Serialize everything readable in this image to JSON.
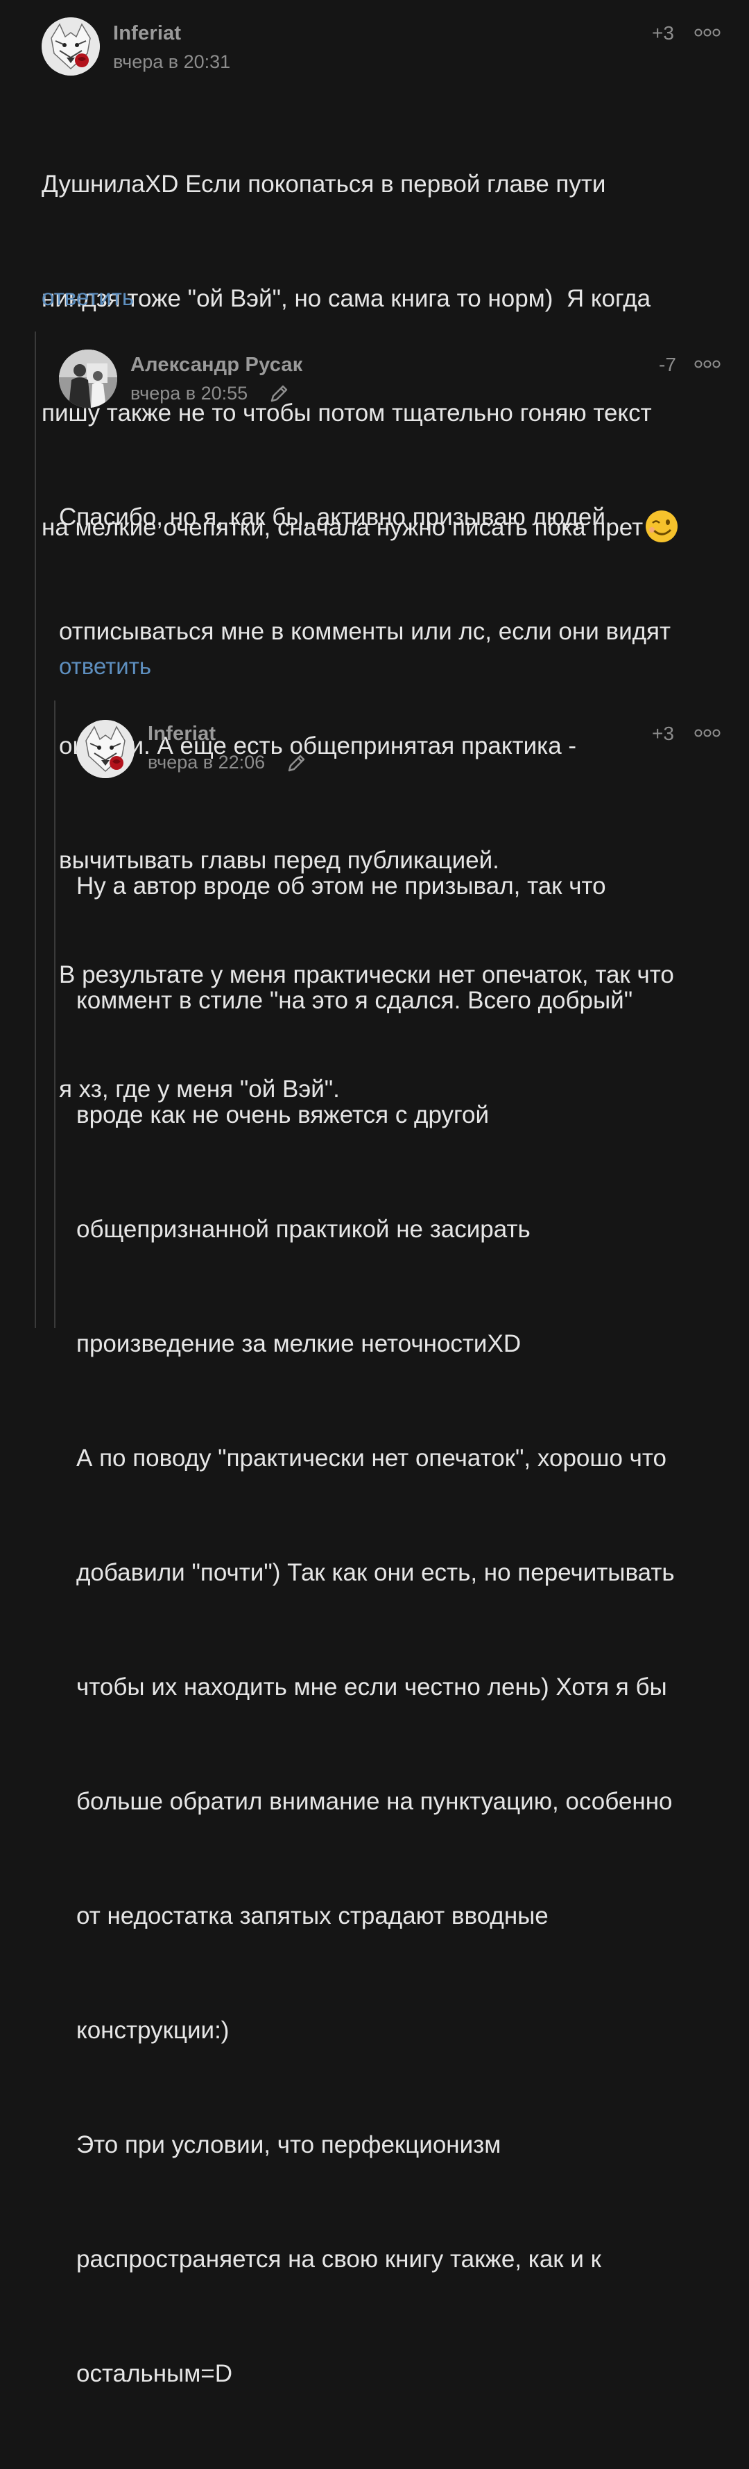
{
  "comments": [
    {
      "author": "Inferiat",
      "time": "вчера в 20:31",
      "rating": "+3",
      "avatar_icon": "wolf-rose-avatar",
      "lines": [
        "ДушнилаXD Если покопаться в первой главе пути",
        "ниндзя тоже \"ой Вэй\", но сама книга то норм)  Я когда",
        "пишу также не то чтобы потом тщательно гоняю текст",
        "на мелкие очепятки, сначала нужно писать пока прет"
      ],
      "emoji": "wink-emoji",
      "reply_label": "ответить"
    },
    {
      "author": "Александр Русак",
      "time": "вчера в 20:55",
      "rating": "-7",
      "avatar_icon": "photo-avatar",
      "edited_icon": "pencil-icon",
      "lines": [
        "Спасибо, но я, как бы, активно призываю людей",
        "отписываться мне в комменты или лс, если они видят",
        "ошибки. А еще есть общепринятая практика -",
        "вычитывать главы перед публикацией.",
        "В результате у меня практически нет опечаток, так что",
        "я хз, где у меня \"ой Вэй\"."
      ],
      "reply_label": "ответить"
    },
    {
      "author": "Inferiat",
      "time": "вчера в 22:06",
      "rating": "+3",
      "avatar_icon": "wolf-rose-avatar",
      "edited_icon": "pencil-icon",
      "lines": [
        "Ну а автор вроде об этом не призывал, так что",
        "коммент в стиле \"на это я сдался. Всего добрый\"",
        "вроде как не очень вяжется с другой",
        "общепризнанной практикой не засирать",
        "произведение за мелкие неточностиXD",
        "А по поводу \"практически нет опечаток\", хорошо что",
        "добавили \"почти\") Так как они есть, но перечитывать",
        "чтобы их находить мне если честно лень) Хотя я бы",
        "больше обратил внимание на пунктуацию, особенно",
        "от недостатка запятых страдают вводные",
        "конструкции:)",
        "Это при условии, что перфекционизм",
        "распространяется на свою книгу также, как и к",
        "остальным=D"
      ]
    }
  ],
  "colors": {
    "background": "#151515",
    "text": "#e6e6e6",
    "meta": "#8d8d8d",
    "link": "#5e8fbf",
    "thread_line": "#3a3a3a"
  }
}
